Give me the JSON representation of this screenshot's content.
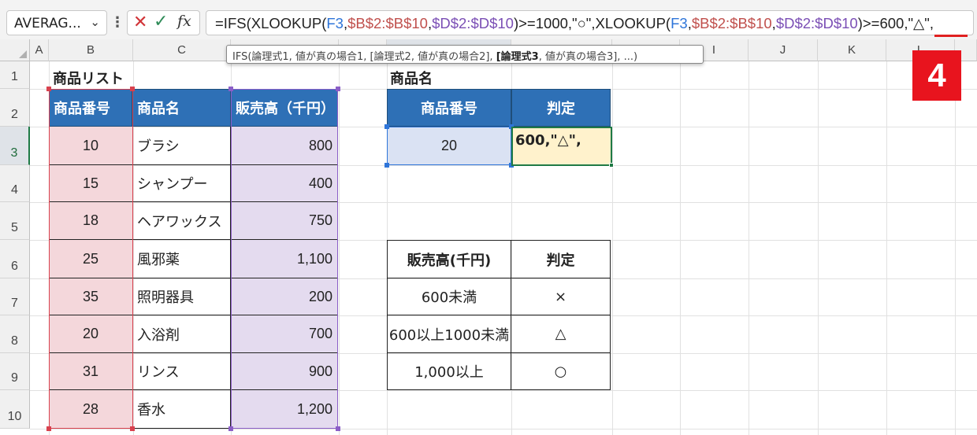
{
  "formula_bar": {
    "name_box": "AVERAG...",
    "fx_label": "fx",
    "formula_parts": [
      {
        "text": "=IFS(XLOOKUP(",
        "color": "#222222"
      },
      {
        "text": "F3",
        "color": "#2e75d9"
      },
      {
        "text": ",",
        "color": "#222222"
      },
      {
        "text": "$B$2:$B$10",
        "color": "#c0504d"
      },
      {
        "text": ",",
        "color": "#222222"
      },
      {
        "text": "$D$2:$D$10",
        "color": "#7b4fb5"
      },
      {
        "text": ")>=1000,\"○\",XLOOKUP(",
        "color": "#222222"
      },
      {
        "text": "F3",
        "color": "#2e75d9"
      },
      {
        "text": ",",
        "color": "#222222"
      },
      {
        "text": "$B$2:$B$10",
        "color": "#c0504d"
      },
      {
        "text": ",",
        "color": "#222222"
      },
      {
        "text": "$D$2:$D$10",
        "color": "#7b4fb5"
      },
      {
        "text": ")>=600,\"△\",",
        "color": "#222222"
      }
    ]
  },
  "tooltip": {
    "prefix": "IFS(論理式1, 値が真の場合1, [論理式2, 値が真の場合2], ",
    "bold": "[論理式3",
    "suffix": ", 値が真の場合3], ...)"
  },
  "badge": "4",
  "columns": [
    "A",
    "B",
    "C",
    "D",
    "E",
    "F",
    "G",
    "H",
    "I",
    "J",
    "K",
    "L"
  ],
  "rows": [
    "1",
    "2",
    "3",
    "4",
    "5",
    "6",
    "7",
    "8",
    "9",
    "10"
  ],
  "product_list": {
    "title": "商品リスト",
    "headers": [
      "商品番号",
      "商品名",
      "販売高（千円）"
    ],
    "rows": [
      [
        "10",
        "ブラシ",
        "800"
      ],
      [
        "15",
        "シャンプー",
        "400"
      ],
      [
        "18",
        "ヘアワックス",
        "750"
      ],
      [
        "25",
        "風邪薬",
        "1,100"
      ],
      [
        "35",
        "照明器具",
        "200"
      ],
      [
        "20",
        "入浴剤",
        "700"
      ],
      [
        "31",
        "リンス",
        "900"
      ],
      [
        "28",
        "香水",
        "1,200"
      ]
    ]
  },
  "lookup": {
    "title": "商品名",
    "headers": [
      "商品番号",
      "判定"
    ],
    "product_number": "20",
    "edit_text": "600,\"△\","
  },
  "criteria": {
    "headers": [
      "販売高(千円)",
      "判定"
    ],
    "rows": [
      [
        "600未満",
        "×"
      ],
      [
        "600以上1000未満",
        "△"
      ],
      [
        "1,000以上",
        "○"
      ]
    ]
  },
  "colors": {
    "header_fill": "#2e70b6",
    "red_range": "#d9414e",
    "purple_range": "#8b5ec7",
    "blue_range": "#2e75d9",
    "active_cell": "#1f7a45",
    "badge": "#e8141e"
  }
}
